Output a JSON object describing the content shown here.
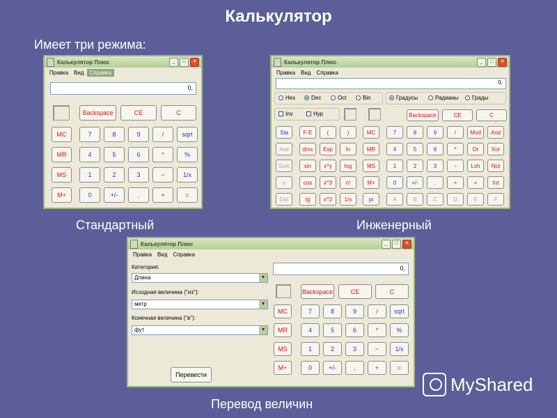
{
  "slide": {
    "title": "Калькулятор",
    "subtitle": "Имеет три режима:",
    "caption_standard": "Стандартный",
    "caption_scientific": "Инженерный",
    "caption_converter": "Перевод величин",
    "logo_text": "MyShared"
  },
  "window": {
    "title": "Калькулятор Плюс",
    "minimize_glyph": "_",
    "maximize_glyph": "□",
    "close_glyph": "✕",
    "menu": [
      "Правка",
      "Вид",
      "Справка"
    ]
  },
  "display_value": "0,",
  "buttons": {
    "backspace": "Backspace",
    "ce": "CE",
    "c": "C",
    "mc": "MC",
    "mr": "MR",
    "ms": "MS",
    "mplus": "M+",
    "d7": "7",
    "d8": "8",
    "d9": "9",
    "div": "/",
    "sqrt": "sqrt",
    "d4": "4",
    "d5": "5",
    "d6": "6",
    "mul": "*",
    "pct": "%",
    "d1": "1",
    "d2": "2",
    "d3": "3",
    "sub": "−",
    "inv": "1/x",
    "d0": "0",
    "sign": "+/-",
    "dot": ".",
    "add": "+",
    "eq": "=",
    "comma": ","
  },
  "scientific": {
    "radios_base": [
      "Hex",
      "Dec",
      "Oct",
      "Bin"
    ],
    "radios_angle": [
      "Градусы",
      "Радианы",
      "Грады"
    ],
    "checks": [
      "Inv",
      "Hyp"
    ],
    "stat": [
      "Sta",
      "Ave",
      "Sum",
      "s",
      "Dat"
    ],
    "funcs": [
      "F-E",
      "(",
      ")",
      "dms",
      "Exp",
      "ln",
      "sin",
      "x^y",
      "log",
      "cos",
      "x^3",
      "n!",
      "tg",
      "x^2",
      "1/x"
    ],
    "right": [
      "Mod",
      "And",
      "Or",
      "Xor",
      "Lsh",
      "Not",
      "=",
      "Int"
    ],
    "pi": "pi",
    "hex_letters": [
      "A",
      "B",
      "C",
      "D",
      "E",
      "F"
    ]
  },
  "converter": {
    "category_label": "Категория:",
    "category_value": "Длина",
    "from_label": "Исходная величина (\"из\"):",
    "from_value": "метр",
    "to_label": "Конечная величина (\"в\"):",
    "to_value": "фут",
    "convert_button": "Перевести"
  },
  "colors": {
    "background": "#5c5e99",
    "digit_blue": "#1a3fbf",
    "operator_red": "#e01010"
  }
}
